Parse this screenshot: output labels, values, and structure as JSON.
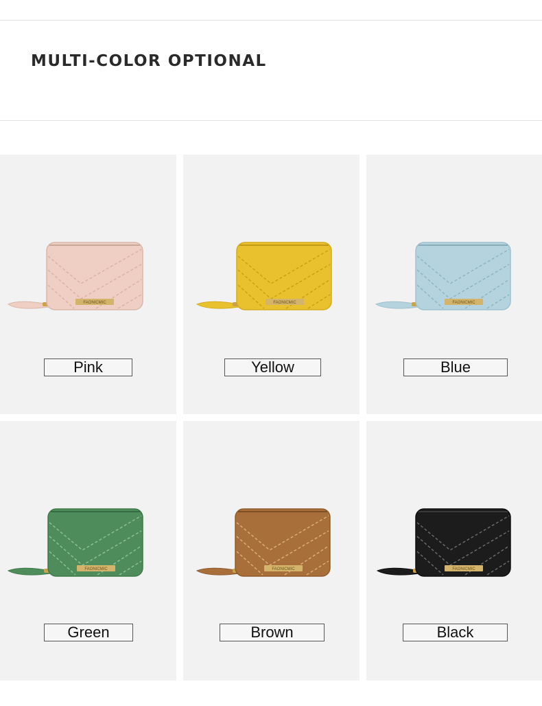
{
  "heading": "MULTI-COLOR OPTIONAL",
  "brand_plate": "FAONICMIC",
  "colors": [
    {
      "label": "Pink",
      "hex": "#efcfc3",
      "stitch": "#dcb2a3",
      "edge": "#d9b8ab"
    },
    {
      "label": "Yellow",
      "hex": "#e9c12f",
      "stitch": "#c99f16",
      "edge": "#d4ac1c"
    },
    {
      "label": "Blue",
      "hex": "#b5d3df",
      "stitch": "#8fb3c2",
      "edge": "#9fc0cd"
    },
    {
      "label": "Green",
      "hex": "#4e8d5b",
      "stitch": "#8cbf96",
      "edge": "#3f7a4b"
    },
    {
      "label": "Brown",
      "hex": "#a86f3a",
      "stitch": "#d9ad7c",
      "edge": "#8f5c2c"
    },
    {
      "label": "Black",
      "hex": "#1c1c1c",
      "stitch": "#6a6a6a",
      "edge": "#0f0f0f"
    }
  ]
}
